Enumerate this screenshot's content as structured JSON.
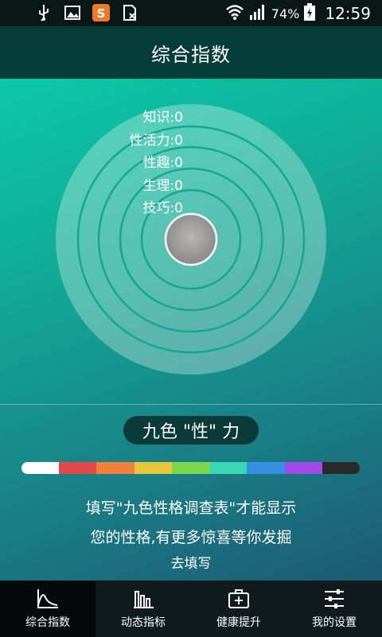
{
  "status_bar": {
    "battery": "74%",
    "time": "12:59",
    "icons": [
      "usb-icon",
      "image-icon",
      "sogou-input-icon",
      "sim-card-icon",
      "wifi-icon",
      "signal-icon",
      "battery-charging-icon"
    ]
  },
  "header": {
    "title": "综合指数"
  },
  "scores": [
    {
      "label": "知识:0"
    },
    {
      "label": "性活力:0"
    },
    {
      "label": "性趣:0"
    },
    {
      "label": "生理:0"
    },
    {
      "label": "技巧:0"
    }
  ],
  "badge": {
    "text": "九色 \"性\" 力"
  },
  "color_bar": [
    "#ffffff",
    "#e24a4a",
    "#f0803a",
    "#e8c83a",
    "#7cd84a",
    "#3ad8b0",
    "#3a90e0",
    "#a24ae8",
    "#2a2a2a"
  ],
  "message": {
    "line1": "填写\"九色性格调查表\"才能显示",
    "line2": "您的性格,有更多惊喜等你发掘"
  },
  "fill_link": "去填写",
  "nav": {
    "items": [
      {
        "label": "综合指数",
        "icon": "area-chart-icon",
        "active": true
      },
      {
        "label": "动态指标",
        "icon": "bar-chart-icon",
        "active": false
      },
      {
        "label": "健康提升",
        "icon": "medical-kit-icon",
        "active": false
      },
      {
        "label": "我的设置",
        "icon": "sliders-icon",
        "active": false
      }
    ]
  }
}
